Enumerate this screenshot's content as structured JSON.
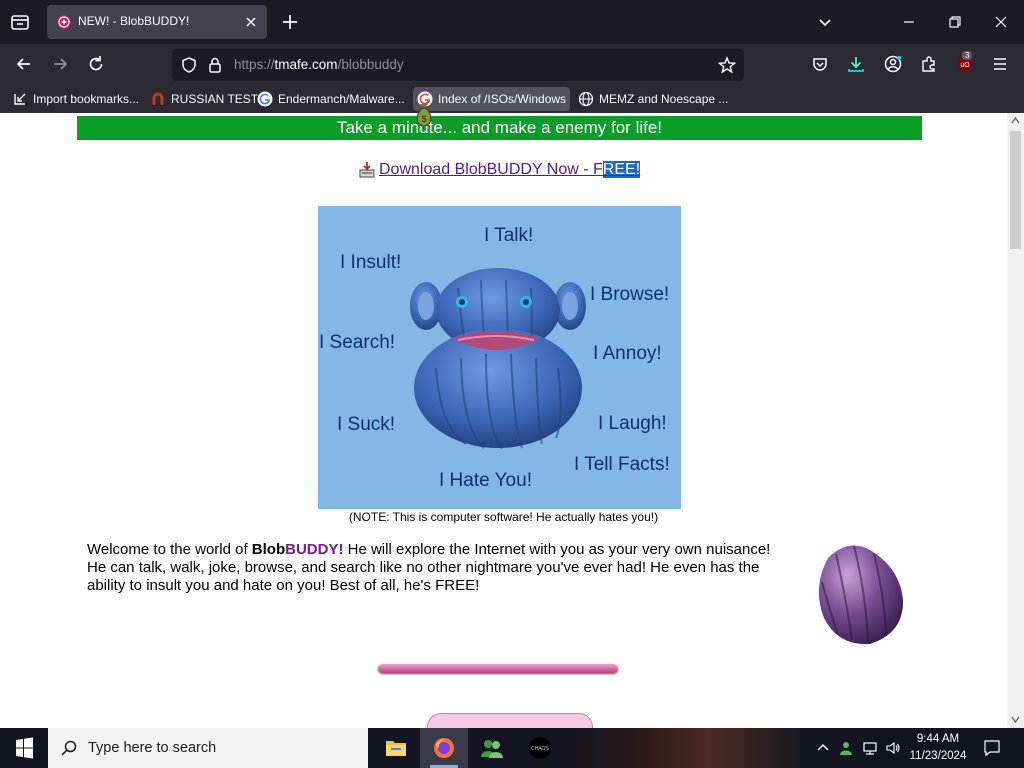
{
  "browser": {
    "tab": {
      "title": "NEW! - BlobBUDDY!"
    },
    "url": {
      "scheme": "https://",
      "host": "tmafe.com",
      "path": "/blobbuddy"
    },
    "extension_badge": "3",
    "bookmarks": [
      {
        "label": "Import bookmarks..."
      },
      {
        "label": "RUSSIAN TEST"
      },
      {
        "label": "Endermanch/Malware..."
      },
      {
        "label": "Index of /ISOs/Windows"
      },
      {
        "label": "MEMZ and Noescape ..."
      }
    ]
  },
  "page": {
    "banner": "Take a minute... and make a enemy for life!",
    "download_link": {
      "text_before": "Download BlobBUDDY Now - F",
      "text_selected": "REE!"
    },
    "bb_words": {
      "talk": "I Talk!",
      "insult": "I Insult!",
      "browse": "I Browse!",
      "search": "I Search!",
      "annoy": "I Annoy!",
      "suck": "I Suck!",
      "laugh": "I Laugh!",
      "facts": "I Tell Facts!",
      "hate": "I Hate You!"
    },
    "note": "(NOTE: This is computer software! He actually hates you!)",
    "welcome": {
      "p1": "Welcome to the world of ",
      "blob": "Blob",
      "buddy": "BUDDY!",
      "p2": " He will explore the Internet with you as your very own nuisance!  He can talk, walk, joke, browse, and search like no other nightmare you've ever had! He even has the ability to insult you and hate on you! Best of all, he's FREE!"
    }
  },
  "taskbar": {
    "search_placeholder": "Type here to search",
    "time": "9:44 AM",
    "date": "11/23/2024",
    "apps": [
      "file-explorer",
      "firefox",
      "messenger",
      "chaos"
    ]
  },
  "colors": {
    "banner_bg": "#0a9e28",
    "panel_bg": "#84b6e6",
    "link": "#551a8b",
    "buddy_purple": "#7b1b8c"
  }
}
